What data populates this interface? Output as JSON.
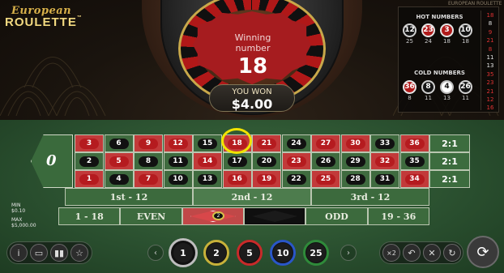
{
  "logo": {
    "line1": "European",
    "line2": "ROULETTE",
    "tm": "™"
  },
  "window_title": "EUROPEAN ROULETTE",
  "result": {
    "label": "Winning number",
    "number": "18",
    "won_label": "YOU WON",
    "won_amount": "$4.00"
  },
  "hot_numbers": {
    "title": "HOT NUMBERS",
    "balls": [
      {
        "n": "12",
        "color": "black",
        "count": "25"
      },
      {
        "n": "23",
        "color": "red",
        "count": "24"
      },
      {
        "n": "3",
        "color": "red",
        "count": "18"
      },
      {
        "n": "10",
        "color": "black",
        "count": "18"
      }
    ]
  },
  "cold_numbers": {
    "title": "COLD NUMBERS",
    "balls": [
      {
        "n": "36",
        "color": "red",
        "count": "8"
      },
      {
        "n": "8",
        "color": "black",
        "count": "11"
      },
      {
        "n": "4",
        "color": "white",
        "count": "13"
      },
      {
        "n": "26",
        "color": "black",
        "count": "11"
      }
    ]
  },
  "history": [
    {
      "n": "18",
      "c": "red"
    },
    {
      "n": "8",
      "c": "black"
    },
    {
      "n": "9",
      "c": "red"
    },
    {
      "n": "21",
      "c": "red"
    },
    {
      "n": "8",
      "c": "red"
    },
    {
      "n": "11",
      "c": "black"
    },
    {
      "n": "13",
      "c": "black"
    },
    {
      "n": "35",
      "c": "red"
    },
    {
      "n": "23",
      "c": "red"
    },
    {
      "n": "21",
      "c": "red"
    },
    {
      "n": "12",
      "c": "red"
    },
    {
      "n": "16",
      "c": "red"
    }
  ],
  "table": {
    "zero": "0",
    "rows": [
      [
        {
          "n": "3",
          "c": "red"
        },
        {
          "n": "6",
          "c": "black"
        },
        {
          "n": "9",
          "c": "red"
        },
        {
          "n": "12",
          "c": "red"
        },
        {
          "n": "15",
          "c": "black"
        },
        {
          "n": "18",
          "c": "red"
        },
        {
          "n": "21",
          "c": "red"
        },
        {
          "n": "24",
          "c": "black"
        },
        {
          "n": "27",
          "c": "red"
        },
        {
          "n": "30",
          "c": "red"
        },
        {
          "n": "33",
          "c": "black"
        },
        {
          "n": "36",
          "c": "red"
        }
      ],
      [
        {
          "n": "2",
          "c": "black"
        },
        {
          "n": "5",
          "c": "red"
        },
        {
          "n": "8",
          "c": "black"
        },
        {
          "n": "11",
          "c": "black"
        },
        {
          "n": "14",
          "c": "red"
        },
        {
          "n": "17",
          "c": "black"
        },
        {
          "n": "20",
          "c": "black"
        },
        {
          "n": "23",
          "c": "red"
        },
        {
          "n": "26",
          "c": "black"
        },
        {
          "n": "29",
          "c": "black"
        },
        {
          "n": "32",
          "c": "red"
        },
        {
          "n": "35",
          "c": "black"
        }
      ],
      [
        {
          "n": "1",
          "c": "red"
        },
        {
          "n": "4",
          "c": "black"
        },
        {
          "n": "7",
          "c": "red"
        },
        {
          "n": "10",
          "c": "black"
        },
        {
          "n": "13",
          "c": "black"
        },
        {
          "n": "16",
          "c": "red"
        },
        {
          "n": "19",
          "c": "red"
        },
        {
          "n": "22",
          "c": "black"
        },
        {
          "n": "25",
          "c": "red"
        },
        {
          "n": "28",
          "c": "black"
        },
        {
          "n": "31",
          "c": "black"
        },
        {
          "n": "34",
          "c": "red"
        }
      ]
    ],
    "columns": [
      "2:1",
      "2:1",
      "2:1"
    ],
    "dozens": [
      "1st - 12",
      "2nd - 12",
      "3rd - 12"
    ],
    "outside": {
      "low": "1 - 18",
      "even": "EVEN",
      "odd": "ODD",
      "high": "19 - 36"
    },
    "placed_chip_value": "2",
    "limits": {
      "min_label": "MIN",
      "min_value": "$0.10",
      "max_label": "MAX",
      "max_value": "$5,000.00"
    }
  },
  "controls": {
    "left": [
      "i",
      "▭",
      "▮▮",
      "☆"
    ],
    "prev": "‹",
    "next": "›",
    "chips": [
      {
        "v": "1",
        "ring": "#bdbdbd"
      },
      {
        "v": "2",
        "ring": "#c8b13a"
      },
      {
        "v": "5",
        "ring": "#c82a2a"
      },
      {
        "v": "10",
        "ring": "#2a56c8"
      },
      {
        "v": "25",
        "ring": "#2f8a3a"
      }
    ],
    "right": [
      "×2",
      "↶",
      "✕",
      "↻"
    ],
    "spin": "⟳"
  }
}
